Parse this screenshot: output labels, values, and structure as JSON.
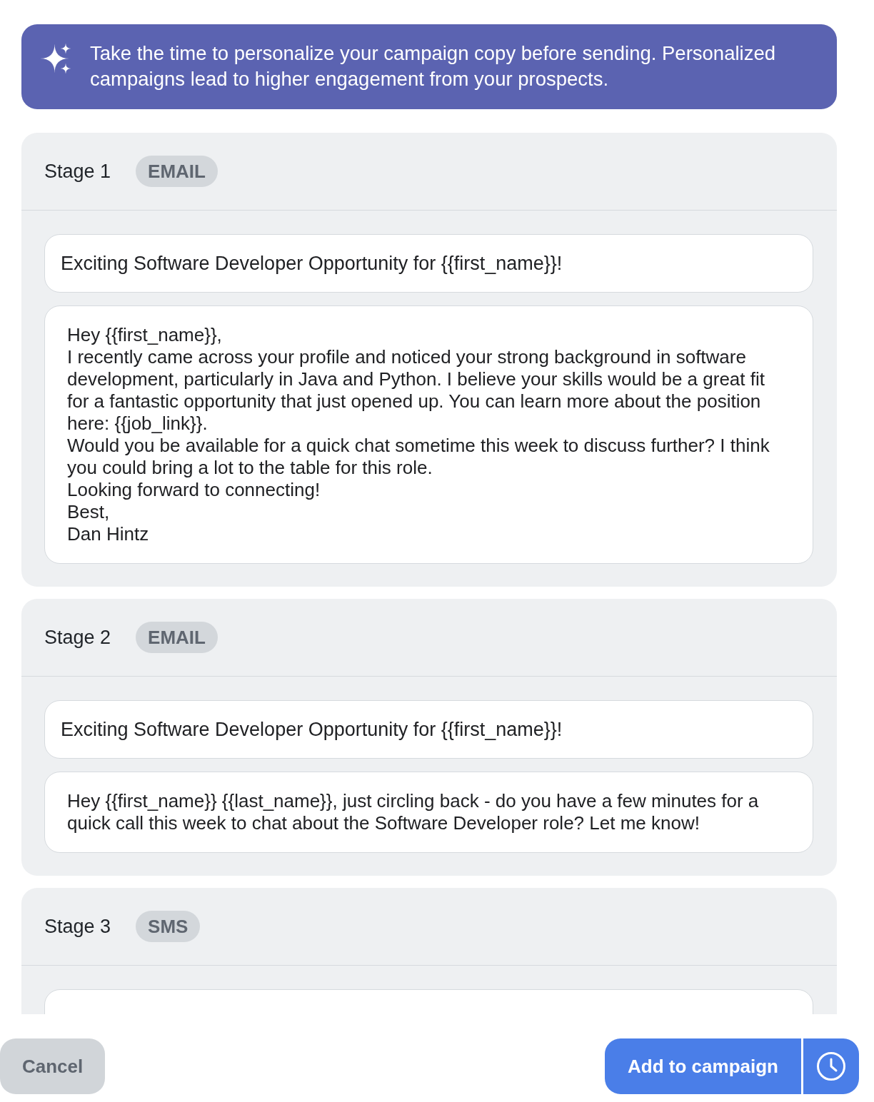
{
  "banner": {
    "text": "Take the time to personalize your campaign copy before sending. Personalized campaigns lead to higher engagement from your prospects."
  },
  "stages": [
    {
      "title": "Stage 1",
      "channel": "EMAIL",
      "fields": [
        {
          "kind": "subject",
          "value": "Exciting Software Developer Opportunity for {{first_name}}!"
        },
        {
          "kind": "body",
          "value": "Hey {{first_name}},\nI recently came across your profile and noticed your strong background in software development, particularly in Java and Python. I believe your skills would be a great fit for a fantastic opportunity that just opened up. You can learn more about the position here: {{job_link}}.\nWould you be available for a quick chat sometime this week to discuss further? I think you could bring a lot to the table for this role.\nLooking forward to connecting!\nBest,\nDan Hintz"
        }
      ]
    },
    {
      "title": "Stage 2",
      "channel": "EMAIL",
      "fields": [
        {
          "kind": "subject",
          "value": "Exciting Software Developer Opportunity for {{first_name}}!"
        },
        {
          "kind": "body",
          "value": "Hey {{first_name}} {{last_name}}, just circling back - do you have a few minutes for a quick call this week to chat about the Software Developer role? Let me know!"
        }
      ]
    },
    {
      "title": "Stage 3",
      "channel": "SMS",
      "fields": [
        {
          "kind": "body"
        }
      ]
    }
  ],
  "footer": {
    "cancel": "Cancel",
    "submit": "Add to campaign"
  }
}
